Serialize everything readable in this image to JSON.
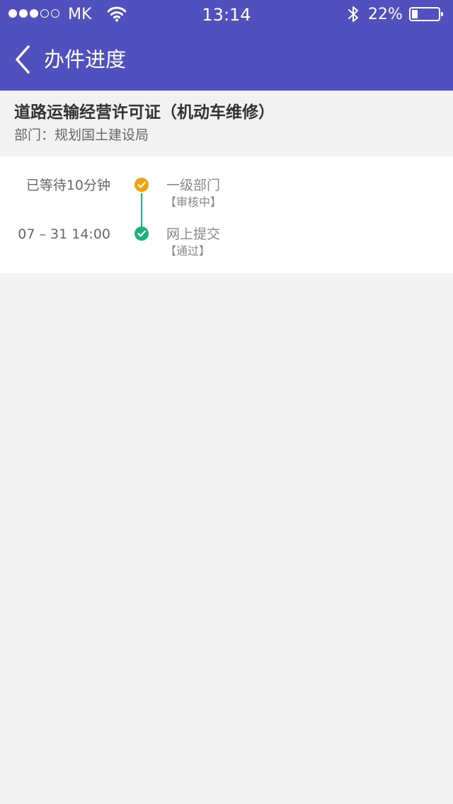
{
  "status_bar": {
    "signal": {
      "filled": 3,
      "total": 5
    },
    "carrier": "MK",
    "time": "13:14",
    "battery_percent": "22%",
    "battery_level": 0.22
  },
  "nav": {
    "title": "办件进度"
  },
  "application": {
    "title": "道路运输经营许可证（机动车维修）",
    "department": "部门：规划国土建设局"
  },
  "timeline": [
    {
      "time": "已等待10分钟",
      "name": "一级部门",
      "status": "【审核中】",
      "color": "#eba313"
    },
    {
      "time": "07 – 31  14:00",
      "name": "网上提交",
      "status": "【通过】",
      "color": "#19b27d"
    }
  ],
  "colors": {
    "header": "#5051be",
    "pending": "#eba313",
    "done": "#19b27d"
  }
}
